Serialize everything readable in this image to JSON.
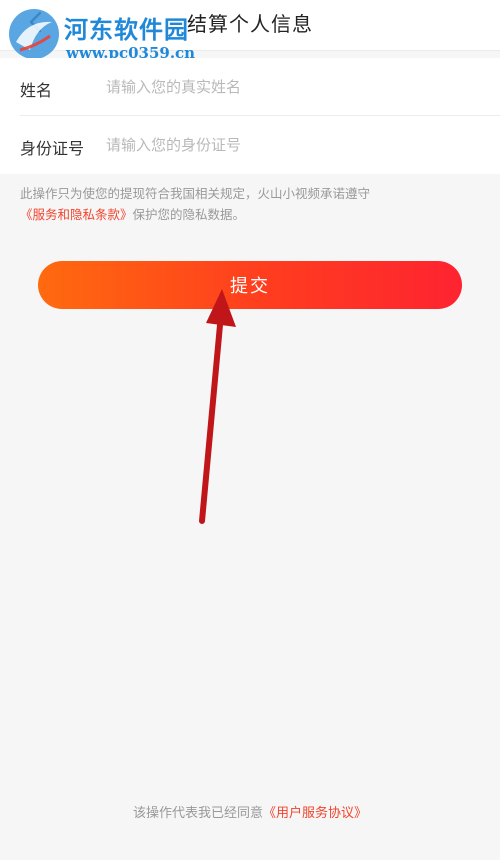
{
  "header": {
    "title": "结算个人信息",
    "back_icon": "chevron-left-icon"
  },
  "watermark": {
    "site_name": "河东软件园",
    "url": "www.pc0359.cn",
    "color": "#1f88d8"
  },
  "form": {
    "name_label": "姓名",
    "name_placeholder": "请输入您的真实姓名",
    "name_value": "",
    "id_label": "身份证号",
    "id_placeholder": "请输入您的身份证号",
    "id_value": ""
  },
  "notice": {
    "text": "此操作只为使您的提现符合我国相关规定，火山小视频承诺遵守",
    "link": "《服务和隐私条款》",
    "suffix": "保护您的隐私数据。"
  },
  "submit": {
    "label": "提交"
  },
  "footer": {
    "text": "该操作代表我已经同意",
    "link": "《用户服务协议》"
  },
  "colors": {
    "accent": "#f2442d",
    "button_gradient_start": "#ff6a0f",
    "button_gradient_end": "#fe2331",
    "arrow": "#c0161a",
    "background": "#f6f6f6"
  }
}
